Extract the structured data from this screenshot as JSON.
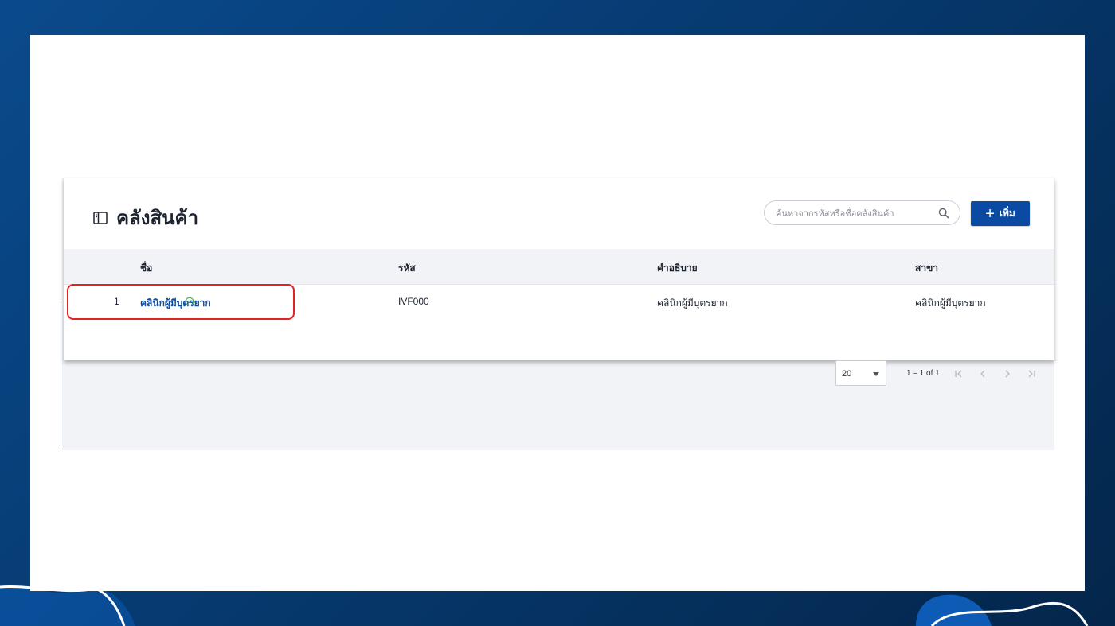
{
  "page": {
    "title": "คลังสินค้า"
  },
  "search": {
    "placeholder": "ค้นหาจากรหัสหรือชื่อคลังสินค้า",
    "value": ""
  },
  "toolbar": {
    "add_label": "เพิ่ม",
    "add_icon": "plus-icon"
  },
  "table": {
    "headers": [
      "ชื่อ",
      "รหัส",
      "คำอธิบาย",
      "สาขา"
    ],
    "rows": [
      {
        "index": "1",
        "name": "คลินิกผู้มีบุตรยาก",
        "code": "IVF000",
        "description": "คลินิกผู้มีบุตรยาก",
        "branch": "คลินิกผู้มีบุตรยาก",
        "status_icon": "check-circle-icon"
      }
    ]
  },
  "pagination": {
    "page_size": "20",
    "range": "1 – 1 of 1"
  },
  "colors": {
    "accent": "#0b4aa3",
    "highlight": "#e02424",
    "background_gradient_start": "#0a4a8c",
    "background_gradient_end": "#04264b"
  }
}
